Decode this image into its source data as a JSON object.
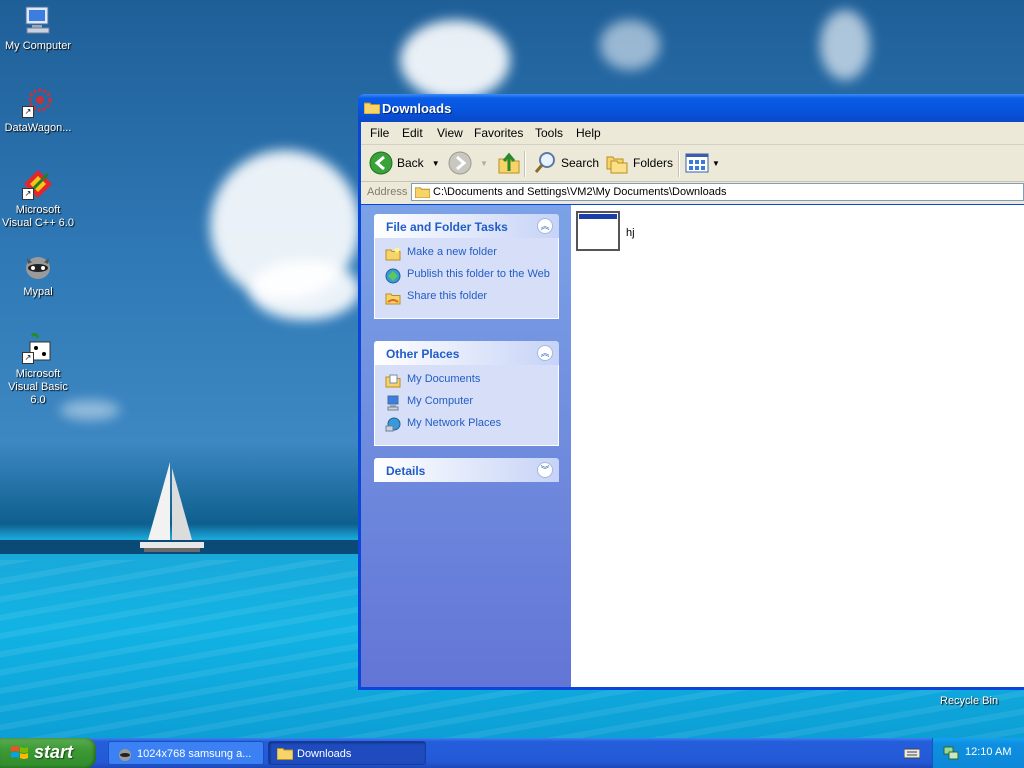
{
  "desktop": {
    "icons": [
      {
        "label": "My Computer",
        "icon": "my-computer-icon"
      },
      {
        "label": "DataWagon...",
        "icon": "datawagon-icon"
      },
      {
        "label": "Microsoft Visual C++ 6.0",
        "icon": "visual-cpp-icon"
      },
      {
        "label": "Mypal",
        "icon": "mypal-raccoon-icon"
      },
      {
        "label": "Microsoft Visual Basic 6.0",
        "icon": "visual-basic-icon"
      }
    ],
    "recycle_bin_label": "Recycle Bin"
  },
  "window": {
    "title": "Downloads",
    "menu": [
      "File",
      "Edit",
      "View",
      "Favorites",
      "Tools",
      "Help"
    ],
    "toolbar": {
      "back_label": "Back",
      "search_label": "Search",
      "folders_label": "Folders"
    },
    "address": {
      "label": "Address",
      "path": "C:\\Documents and Settings\\VM2\\My Documents\\Downloads"
    },
    "taskpane": {
      "file_tasks": {
        "title": "File and Folder Tasks",
        "links": [
          "Make a new folder",
          "Publish this folder to the Web",
          "Share this folder"
        ]
      },
      "other_places": {
        "title": "Other Places",
        "links": [
          "My Documents",
          "My Computer",
          "My Network Places"
        ]
      },
      "details": {
        "title": "Details"
      }
    },
    "files": [
      {
        "name": "hj"
      }
    ]
  },
  "taskbar": {
    "start_label": "start",
    "buttons": [
      {
        "label": "1024x768 samsung a...",
        "icon": "raccoon-icon"
      },
      {
        "label": "Downloads",
        "icon": "folder-icon"
      }
    ],
    "clock": "12:10 AM"
  },
  "colors": {
    "titlebar": "#0654dc",
    "taskbar": "#245edb",
    "start_button": "#3c9a35",
    "link": "#215dc6"
  }
}
